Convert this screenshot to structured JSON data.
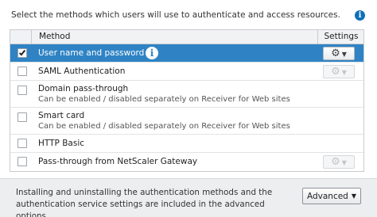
{
  "intro_text": "Select the methods which users will use to authenticate and access resources.",
  "info_glyph": "i",
  "columns": {
    "method": "Method",
    "settings": "Settings"
  },
  "methods": [
    {
      "label": "User name and password",
      "sub": "",
      "checked": true,
      "selected": true,
      "has_info": true,
      "settings": "enabled"
    },
    {
      "label": "SAML Authentication",
      "sub": "",
      "checked": false,
      "selected": false,
      "has_info": false,
      "settings": "disabled"
    },
    {
      "label": "Domain pass-through",
      "sub": "Can be enabled / disabled separately on Receiver for Web sites",
      "checked": false,
      "selected": false,
      "has_info": false,
      "settings": "none"
    },
    {
      "label": "Smart card",
      "sub": "Can be enabled / disabled separately on Receiver for Web sites",
      "checked": false,
      "selected": false,
      "has_info": false,
      "settings": "none"
    },
    {
      "label": "HTTP Basic",
      "sub": "",
      "checked": false,
      "selected": false,
      "has_info": false,
      "settings": "none"
    },
    {
      "label": "Pass-through from NetScaler Gateway",
      "sub": "",
      "checked": false,
      "selected": false,
      "has_info": false,
      "settings": "disabled"
    }
  ],
  "footer": {
    "text": "Installing and uninstalling the authentication methods and the authentication service settings are included in the advanced options.",
    "advanced_label": "Advanced"
  },
  "icons": {
    "info": "info-icon",
    "gear": "gear-icon",
    "caret": "caret-down-icon",
    "check": "check-icon"
  },
  "colors": {
    "selection": "#2f83c4",
    "info": "#0f6fb8",
    "footer_bg": "#eceef0"
  }
}
